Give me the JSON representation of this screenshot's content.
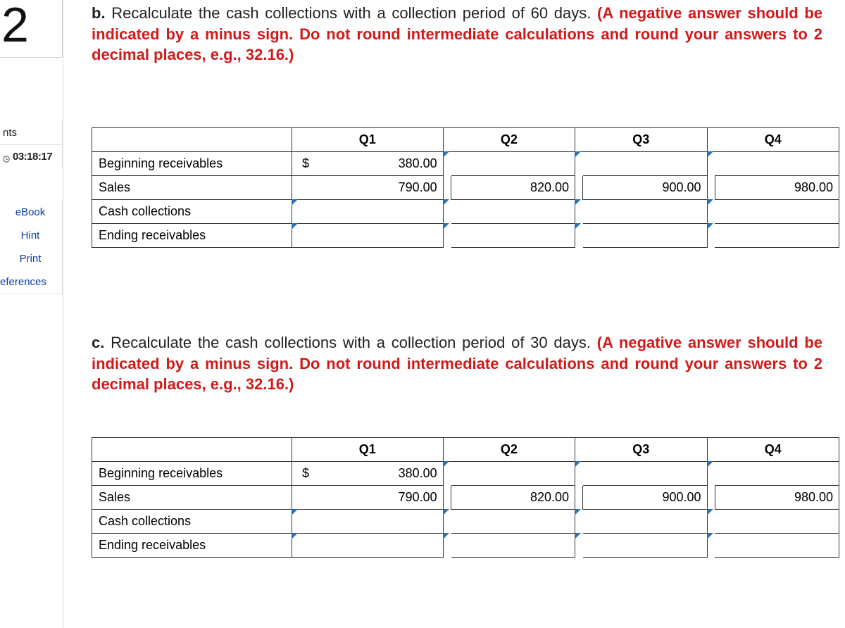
{
  "sidebar": {
    "question_number": "2",
    "nts_label": "nts",
    "timer": "03:18:17",
    "ebook": "eBook",
    "hint": "Hint",
    "print": "Print",
    "references": "eferences"
  },
  "section_b": {
    "lead_label": "b.",
    "lead_text": " Recalculate the cash collections with a collection period of 60 days. ",
    "red_text": "(A negative answer should be indicated by a minus sign. Do not round intermediate calculations and round your answers to 2 decimal places, e.g., 32.16.)"
  },
  "section_c": {
    "lead_label": "c.",
    "lead_text": " Recalculate the cash collections with a collection period of 30 days. ",
    "red_text": "(A negative answer should be indicated by a minus sign. Do not round intermediate calculations and round your answers to 2 decimal places, e.g., 32.16.)"
  },
  "table": {
    "headers": {
      "q1": "Q1",
      "q2": "Q2",
      "q3": "Q3",
      "q4": "Q4"
    },
    "rows": {
      "beginning_receivables": "Beginning receivables",
      "sales": "Sales",
      "cash_collections": "Cash collections",
      "ending_receivables": "Ending receivables"
    },
    "currency": "$",
    "data_b": {
      "beginning_receivables": {
        "q1": "380.00",
        "q2": "",
        "q3": "",
        "q4": ""
      },
      "sales": {
        "q1": "790.00",
        "q2": "820.00",
        "q3": "900.00",
        "q4": "980.00"
      },
      "cash_collections": {
        "q1": "",
        "q2": "",
        "q3": "",
        "q4": ""
      },
      "ending_receivables": {
        "q1": "",
        "q2": "",
        "q3": "",
        "q4": ""
      }
    },
    "data_c": {
      "beginning_receivables": {
        "q1": "380.00",
        "q2": "",
        "q3": "",
        "q4": ""
      },
      "sales": {
        "q1": "790.00",
        "q2": "820.00",
        "q3": "900.00",
        "q4": "980.00"
      },
      "cash_collections": {
        "q1": "",
        "q2": "",
        "q3": "",
        "q4": ""
      },
      "ending_receivables": {
        "q1": "",
        "q2": "",
        "q3": "",
        "q4": ""
      }
    }
  },
  "chart_data": [
    {
      "type": "table",
      "title": "Cash collections — 60-day collection period",
      "columns": [
        "Q1",
        "Q2",
        "Q3",
        "Q4"
      ],
      "rows": [
        {
          "label": "Beginning receivables",
          "values": [
            380.0,
            null,
            null,
            null
          ]
        },
        {
          "label": "Sales",
          "values": [
            790.0,
            820.0,
            900.0,
            980.0
          ]
        },
        {
          "label": "Cash collections",
          "values": [
            null,
            null,
            null,
            null
          ]
        },
        {
          "label": "Ending receivables",
          "values": [
            null,
            null,
            null,
            null
          ]
        }
      ]
    },
    {
      "type": "table",
      "title": "Cash collections — 30-day collection period",
      "columns": [
        "Q1",
        "Q2",
        "Q3",
        "Q4"
      ],
      "rows": [
        {
          "label": "Beginning receivables",
          "values": [
            380.0,
            null,
            null,
            null
          ]
        },
        {
          "label": "Sales",
          "values": [
            790.0,
            820.0,
            900.0,
            980.0
          ]
        },
        {
          "label": "Cash collections",
          "values": [
            null,
            null,
            null,
            null
          ]
        },
        {
          "label": "Ending receivables",
          "values": [
            null,
            null,
            null,
            null
          ]
        }
      ]
    }
  ]
}
